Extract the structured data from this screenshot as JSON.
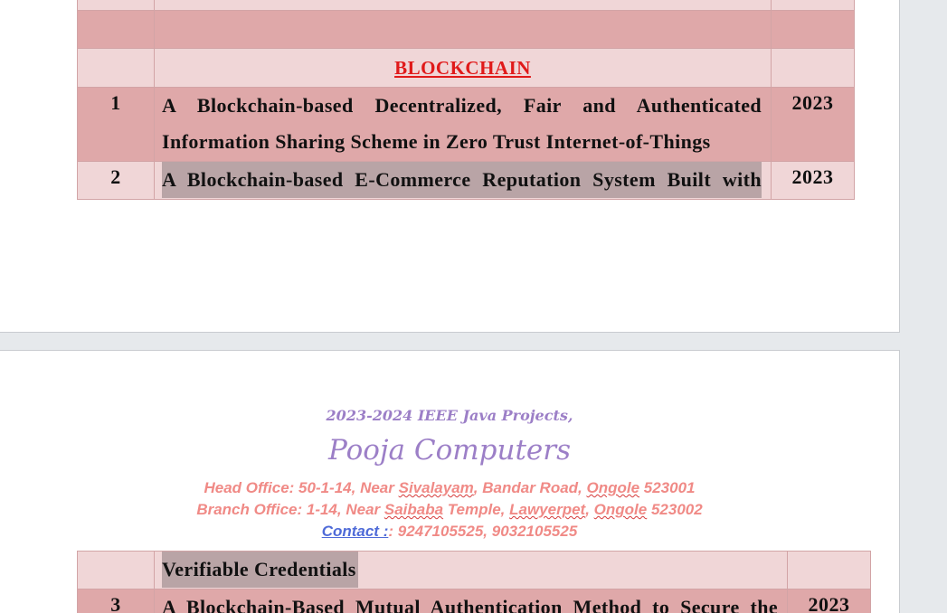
{
  "document": {
    "section_heading": "BLOCKCHAIN",
    "rows": [
      {
        "num": "1",
        "title_line1": "A Blockchain-based Decentralized, Fair and Authenticated",
        "title_line2": "Information Sharing Scheme in Zero Trust Internet-of-Things",
        "year": "2023"
      },
      {
        "num": "2",
        "title_line1": "A Blockchain-based E-Commerce Reputation System Built with",
        "year": "2023"
      }
    ],
    "header": {
      "line1": "2023-2024 IEEE Java Projects,",
      "company": "Pooja Computers",
      "head_office": {
        "prefix": "Head Office: 50-1-14, Near ",
        "word1": "Sivalayam",
        "mid": ", Bandar Road, ",
        "word2": "Ongole",
        "suffix": " 523001"
      },
      "branch_office": {
        "prefix": "Branch Office: 1-14, Near ",
        "word1": "Saibaba",
        "mid1": " Temple, ",
        "word2": "Lawyerpet",
        "mid2": ", ",
        "word3": "Ongole",
        "suffix": " 523002"
      },
      "contact": {
        "label": "Contact :",
        "numbers": ": 9247105525, 9032105525"
      }
    },
    "page2_rows": [
      {
        "title": "Verifiable Credentials"
      },
      {
        "num": "3",
        "title_line1": "A Blockchain-Based Mutual Authentication Method to Secure the",
        "year": "2023"
      }
    ]
  },
  "colors": {
    "row_dark": "#dfa8a9",
    "row_light": "#f0d6d7",
    "heading_red": "#e01a1a",
    "header_purple": "#9c7fc7",
    "address_pink": "#f08a86"
  }
}
